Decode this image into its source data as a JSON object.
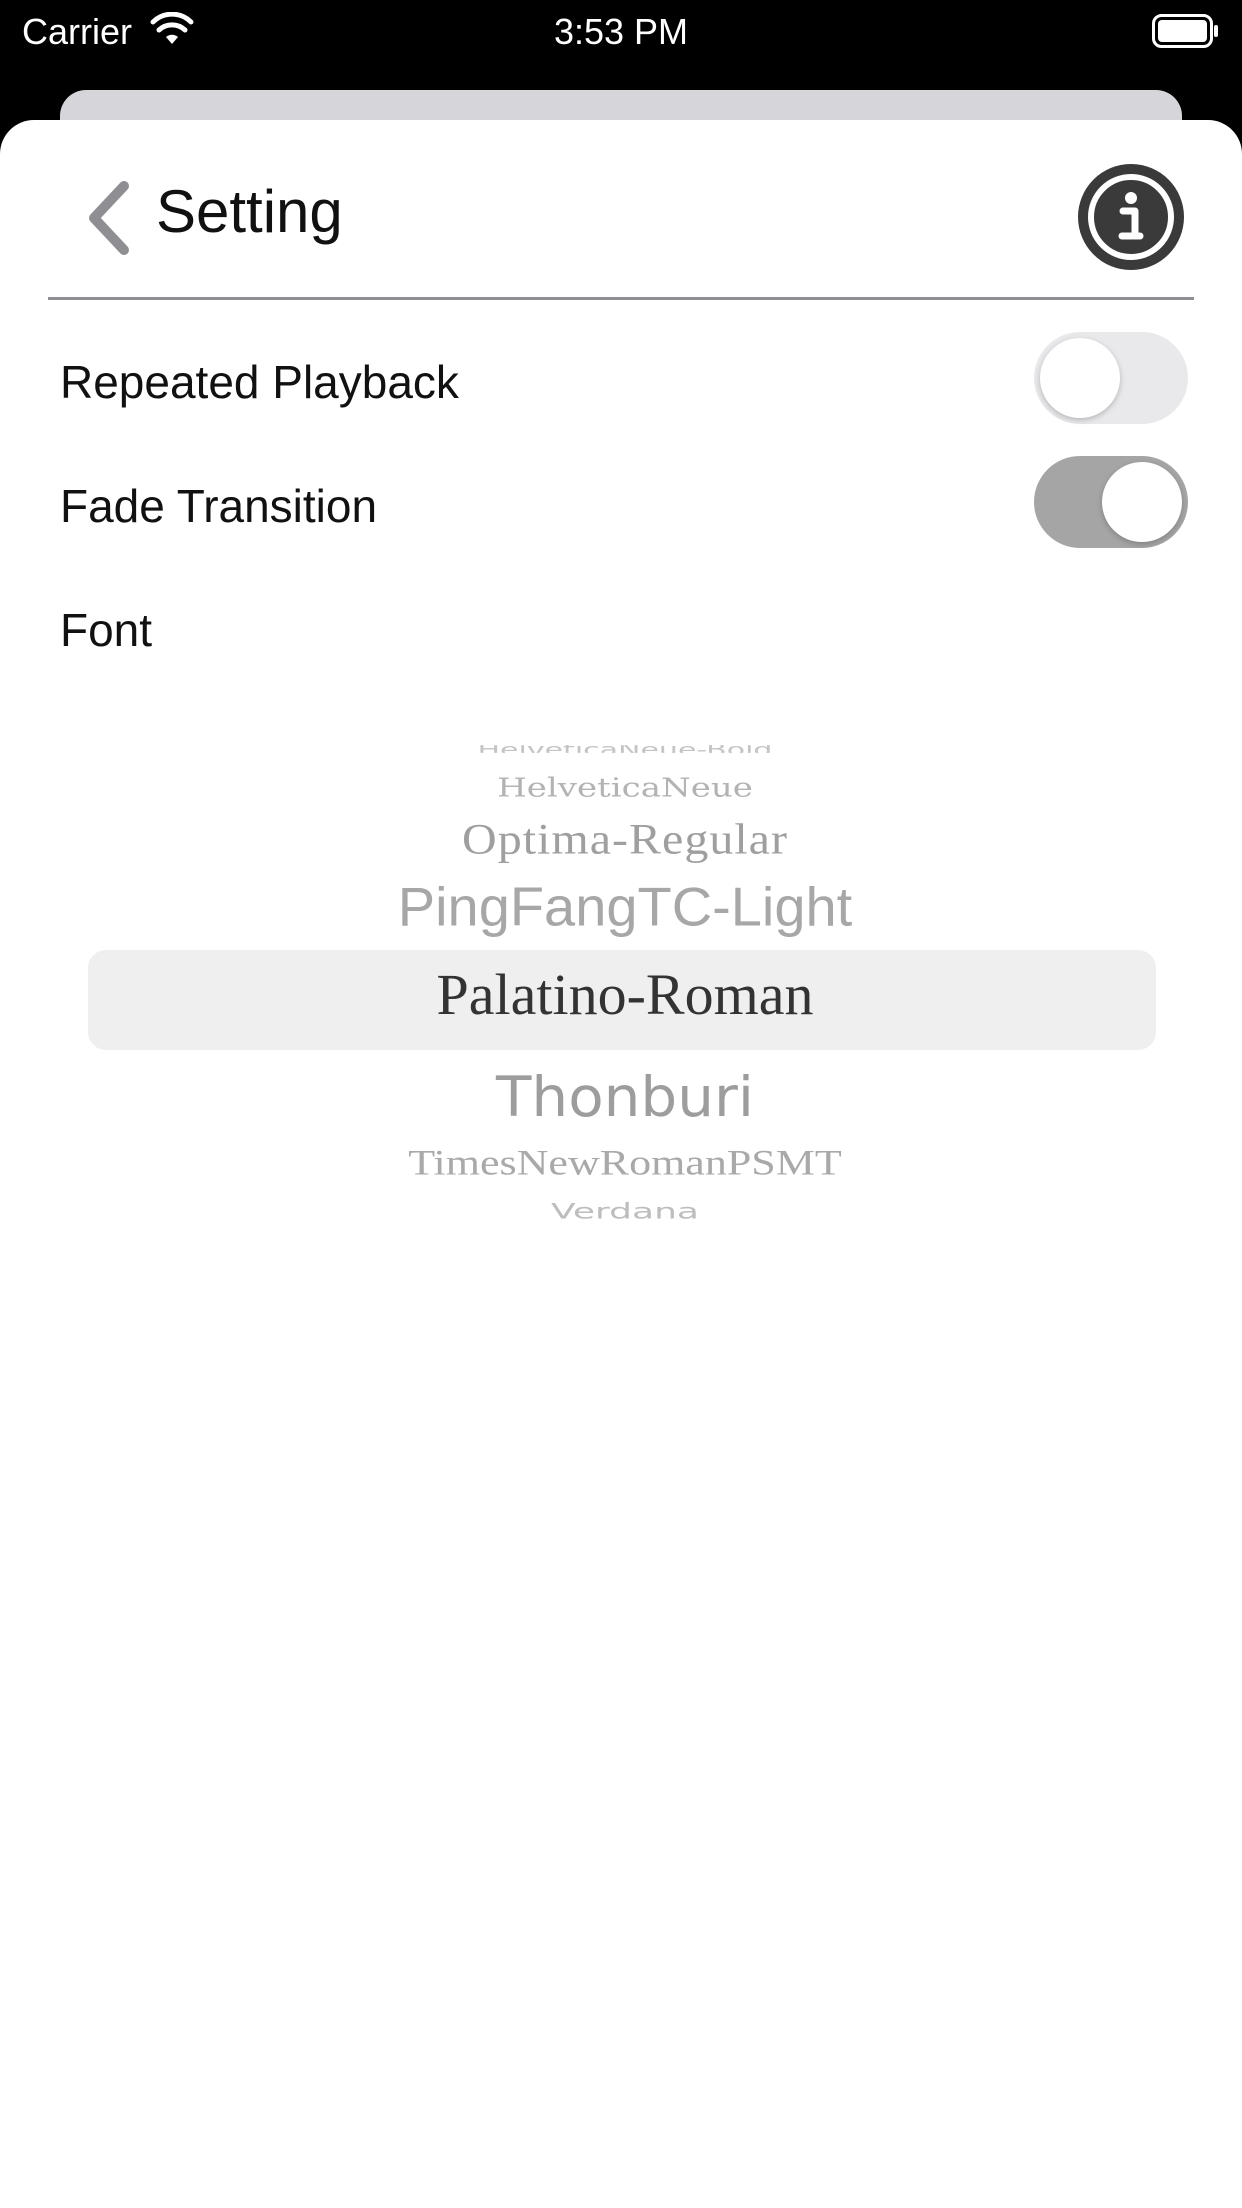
{
  "status_bar": {
    "carrier": "Carrier",
    "time": "3:53 PM",
    "wifi_icon": "wifi-icon",
    "battery_icon": "battery-full-icon"
  },
  "nav": {
    "title": "Setting",
    "back_icon": "chevron-left-icon",
    "info_icon": "info-circle-icon"
  },
  "settings": {
    "repeated_playback": {
      "label": "Repeated Playback",
      "enabled": false
    },
    "fade_transition": {
      "label": "Fade Transition",
      "enabled": true
    },
    "font": {
      "label": "Font"
    }
  },
  "font_picker": {
    "items": [
      "HelveticaNeue-Bold",
      "HelveticaNeue",
      "Optima-Regular",
      "PingFangTC-Light",
      "Palatino-Roman",
      "Thonburi",
      "TimesNewRomanPSMT",
      "Verdana"
    ],
    "selected": "Palatino-Roman"
  },
  "colors": {
    "toggle_on": "#a5a5a5",
    "toggle_off": "#e9e9eb",
    "info_button": "#3a3a3a",
    "back_chevron": "#8e8e93"
  }
}
